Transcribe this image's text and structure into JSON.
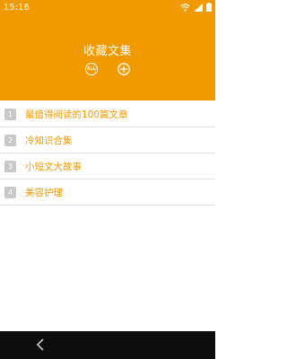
{
  "status_bar": {
    "time": "15:16",
    "icons": [
      "wifi-icon",
      "signal-icon",
      "battery-icon"
    ]
  },
  "header": {
    "title": "收藏文集",
    "all_label": "ALL",
    "add_icon": "plus-circle-icon",
    "background_color": "#f19a00"
  },
  "list": {
    "items": [
      {
        "index": "1",
        "title": "最值得阅读的100篇文章"
      },
      {
        "index": "2",
        "title": "冷知识合集"
      },
      {
        "index": "3",
        "title": "小短文大故事"
      },
      {
        "index": "4",
        "title": "美容护理"
      }
    ],
    "accent_color": "#f19a00"
  },
  "nav_bar": {
    "back_icon": "chevron-left-icon"
  }
}
